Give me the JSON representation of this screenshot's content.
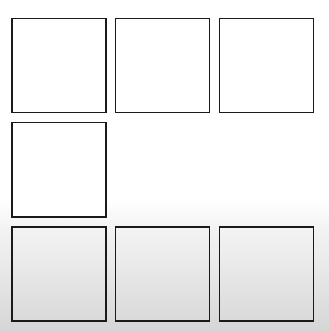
{
  "grid": {
    "rows": [
      [
        "filled",
        "filled",
        "filled"
      ],
      [
        "filled"
      ],
      [
        "empty",
        "empty",
        "empty"
      ]
    ]
  }
}
